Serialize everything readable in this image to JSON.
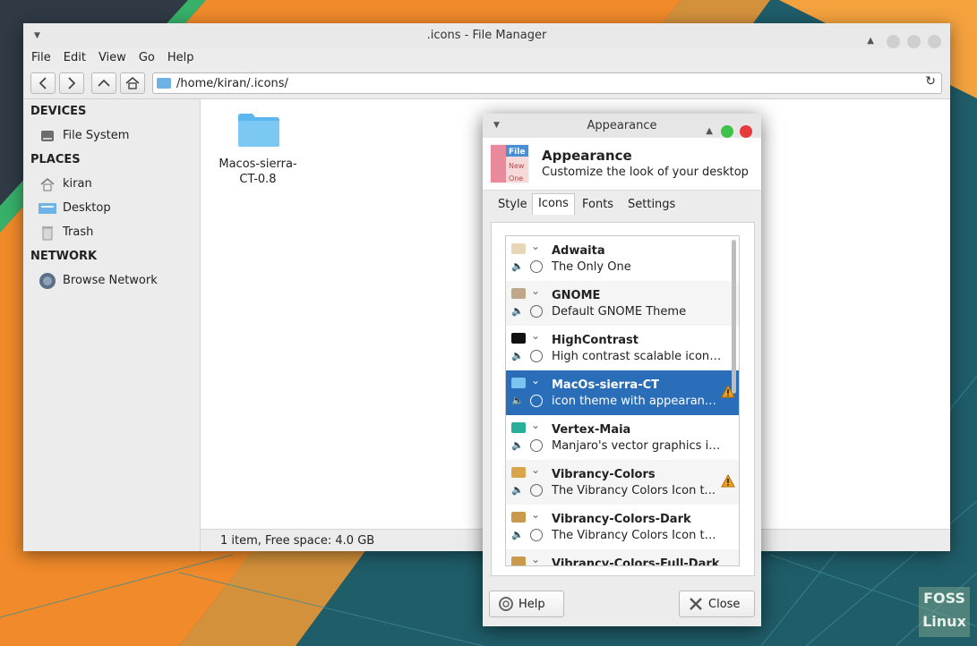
{
  "file_manager": {
    "title": ".icons - File Manager",
    "menu": [
      "File",
      "Edit",
      "View",
      "Go",
      "Help"
    ],
    "location": "/home/kiran/.icons/",
    "sidebar": {
      "devices_header": "DEVICES",
      "devices": [
        {
          "label": "File System",
          "icon": "drive-icon"
        }
      ],
      "places_header": "PLACES",
      "places": [
        {
          "label": "kiran",
          "icon": "home-icon"
        },
        {
          "label": "Desktop",
          "icon": "desktop-icon"
        },
        {
          "label": "Trash",
          "icon": "trash-icon"
        }
      ],
      "network_header": "NETWORK",
      "network": [
        {
          "label": "Browse Network",
          "icon": "network-icon"
        }
      ]
    },
    "items": [
      {
        "name": "Macos-sierra-CT-0.8",
        "icon": "folder-icon"
      }
    ],
    "status": "1 item, Free space: 4.0 GB"
  },
  "appearance": {
    "window_title": "Appearance",
    "header_title": "Appearance",
    "header_subtitle": "Customize the look of your desktop",
    "app_icon_labels": [
      "File",
      "New",
      "One"
    ],
    "tabs": [
      "Style",
      "Icons",
      "Fonts",
      "Settings"
    ],
    "active_tab": "Icons",
    "themes": [
      {
        "name": "Adwaita",
        "desc": "The Only One",
        "folder_color": "#e8d6b8",
        "warn": false,
        "selected": false
      },
      {
        "name": "GNOME",
        "desc": "Default GNOME Theme",
        "folder_color": "#bfa88a",
        "warn": false,
        "selected": false
      },
      {
        "name": "HighContrast",
        "desc": "High contrast scalable icons w...",
        "folder_color": "#111111",
        "warn": false,
        "selected": false
      },
      {
        "name": "MacOs-sierra-CT",
        "desc": "icon theme with appearanc...",
        "folder_color": "#7cc3f2",
        "warn": true,
        "selected": true
      },
      {
        "name": "Vertex-Maia",
        "desc": "Manjaro's vector graphics ico...",
        "folder_color": "#2ab09a",
        "warn": false,
        "selected": false
      },
      {
        "name": "Vibrancy-Colors",
        "desc": "The Vibrancy Colors Icon t...",
        "folder_color": "#d8a54a",
        "warn": true,
        "selected": false
      },
      {
        "name": "Vibrancy-Colors-Dark",
        "desc": "The Vibrancy Colors Icon the...",
        "folder_color": "#c99a4c",
        "warn": false,
        "selected": false
      },
      {
        "name": "Vibrancy-Colors-Full-Dark",
        "desc": "",
        "folder_color": "#c99a4c",
        "warn": false,
        "selected": false
      }
    ],
    "help_label": "Help",
    "close_label": "Close"
  },
  "watermark": {
    "line1": "FOSS",
    "line2": "Linux"
  },
  "colors": {
    "selection": "#2a6db8",
    "warning": "#f0a020",
    "close_dot": "#e83a3a",
    "max_dot": "#3fc24a"
  }
}
